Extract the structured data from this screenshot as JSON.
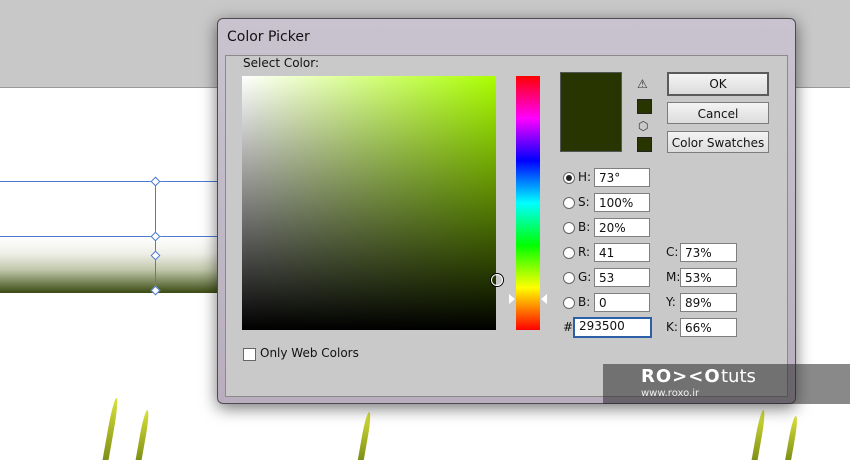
{
  "dialog": {
    "title": "Color Picker",
    "select_label": "Select Color:",
    "only_web_label": "Only Web Colors",
    "only_web_checked": false,
    "buttons": {
      "ok": "OK",
      "cancel": "Cancel",
      "swatches": "Color Swatches"
    },
    "current_color": "#293500",
    "hsb": [
      {
        "label": "H:",
        "value": "73°",
        "selected": true
      },
      {
        "label": "S:",
        "value": "100%",
        "selected": false
      },
      {
        "label": "B:",
        "value": "20%",
        "selected": false
      }
    ],
    "rgb": [
      {
        "label": "R:",
        "value": "41",
        "selected": false
      },
      {
        "label": "G:",
        "value": "53",
        "selected": false
      },
      {
        "label": "B:",
        "value": "0",
        "selected": false
      }
    ],
    "hex_label": "#",
    "hex_value": "293500",
    "cmyk": [
      {
        "label": "C:",
        "value": "73%"
      },
      {
        "label": "M:",
        "value": "53%"
      },
      {
        "label": "Y:",
        "value": "89%"
      },
      {
        "label": "K:",
        "value": "66%"
      }
    ],
    "icons": {
      "warning": "warning-triangle-icon",
      "cube": "web-safe-cube-icon"
    }
  },
  "watermark": {
    "brand": "RO><O",
    "suffix": "tuts",
    "url": "www.roxo.ir"
  }
}
